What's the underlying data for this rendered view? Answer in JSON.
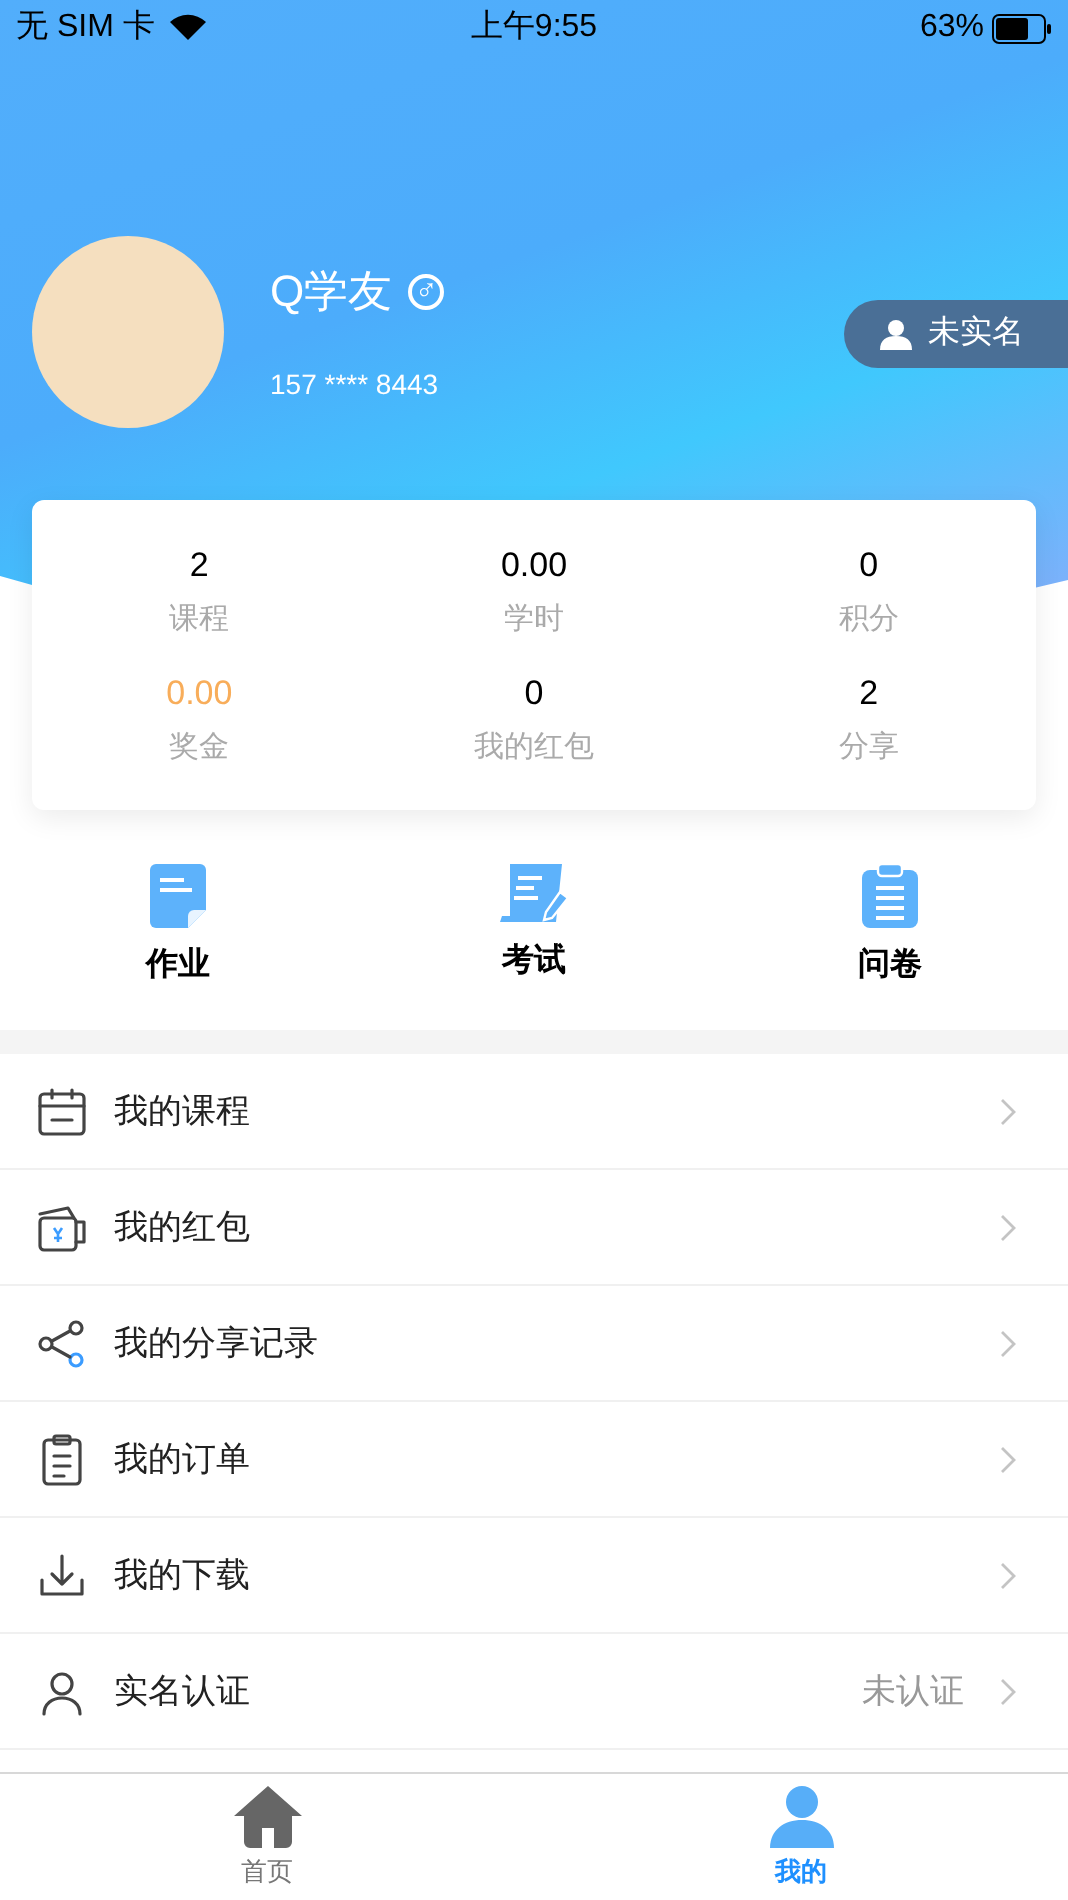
{
  "status_bar": {
    "carrier": "无 SIM 卡",
    "time": "上午9:55",
    "battery": "63%"
  },
  "profile": {
    "name": "Q学友",
    "gender_symbol": "♂",
    "phone": "157 **** 8443",
    "verify_badge": "未实名"
  },
  "stats": [
    {
      "value": "2",
      "label": "课程",
      "highlight": false
    },
    {
      "value": "0.00",
      "label": "学时",
      "highlight": false
    },
    {
      "value": "0",
      "label": "积分",
      "highlight": false
    },
    {
      "value": "0.00",
      "label": "奖金",
      "highlight": true
    },
    {
      "value": "0",
      "label": "我的红包",
      "highlight": false
    },
    {
      "value": "2",
      "label": "分享",
      "highlight": false
    }
  ],
  "shortcuts": [
    {
      "label": "作业",
      "kind": "homework"
    },
    {
      "label": "考试",
      "kind": "exam"
    },
    {
      "label": "问卷",
      "kind": "survey"
    }
  ],
  "menu": [
    {
      "label": "我的课程",
      "kind": "calendar"
    },
    {
      "label": "我的红包",
      "kind": "wallet"
    },
    {
      "label": "我的分享记录",
      "kind": "share"
    },
    {
      "label": "我的订单",
      "kind": "clipboard"
    },
    {
      "label": "我的下载",
      "kind": "download"
    },
    {
      "label": "实名认证",
      "kind": "person",
      "value": "未认证"
    }
  ],
  "tab_bar": [
    {
      "label": "首页",
      "kind": "home",
      "selected": false
    },
    {
      "label": "我的",
      "kind": "me",
      "selected": true
    }
  ]
}
